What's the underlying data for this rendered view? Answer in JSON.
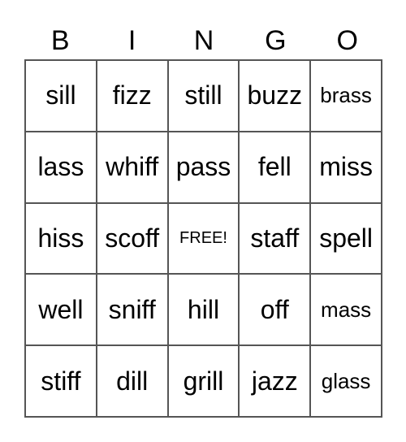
{
  "header": [
    "B",
    "I",
    "N",
    "G",
    "O"
  ],
  "cells": [
    [
      "sill",
      "fizz",
      "still",
      "buzz",
      "brass"
    ],
    [
      "lass",
      "whiff",
      "pass",
      "fell",
      "miss"
    ],
    [
      "hiss",
      "scoff",
      "FREE!",
      "staff",
      "spell"
    ],
    [
      "well",
      "sniff",
      "hill",
      "off",
      "mass"
    ],
    [
      "stiff",
      "dill",
      "grill",
      "jazz",
      "glass"
    ]
  ]
}
